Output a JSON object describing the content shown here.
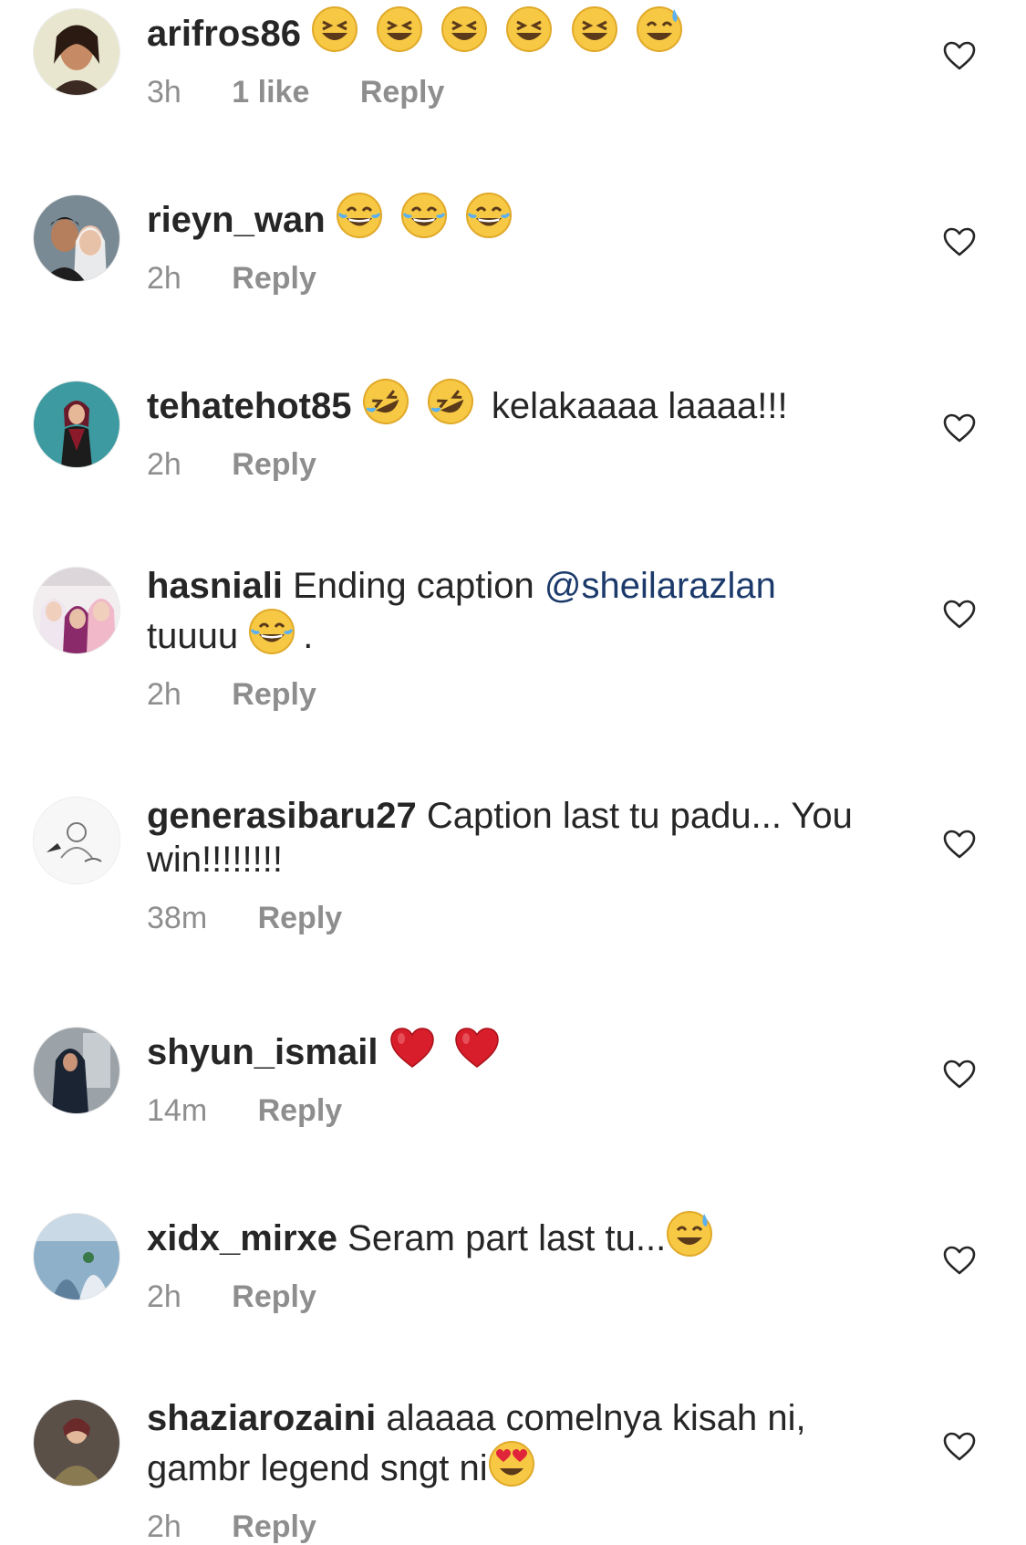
{
  "comments": [
    {
      "username": "arifros86",
      "text": "",
      "emoji": [
        "😆",
        "😆",
        "😆",
        "😆",
        "😆",
        "😅"
      ],
      "time": "3h",
      "likes": "1 like",
      "reply": "Reply"
    },
    {
      "username": "rieyn_wan",
      "text": "",
      "emoji": [
        "😂",
        "😂",
        "😂"
      ],
      "time": "2h",
      "reply": "Reply"
    },
    {
      "username": "tehatehot85",
      "text_after": "kelakaaaa laaaa!!!",
      "emoji": [
        "🤣",
        "🤣"
      ],
      "time": "2h",
      "reply": "Reply"
    },
    {
      "username": "hasniali",
      "text": "Ending caption",
      "mention": "@sheilarazlan",
      "text2": "tuuuu",
      "emoji": [
        "😂"
      ],
      "suffix": ".",
      "time": "2h",
      "reply": "Reply"
    },
    {
      "username": "generasibaru27",
      "text": "Caption last tu padu... You win!!!!!!!!",
      "time": "38m",
      "reply": "Reply"
    },
    {
      "username": "shyun_ismail",
      "emoji": [
        "❤️",
        "❤️"
      ],
      "time": "14m",
      "reply": "Reply"
    },
    {
      "username": "xidx_mirxe",
      "text": "Seram part last tu...",
      "emoji": [
        "😅"
      ],
      "time": "2h",
      "reply": "Reply"
    },
    {
      "username": "shaziarozaini",
      "text": "alaaaa comelnya kisah ni, gambr legend sngt ni",
      "emoji": [
        "😍"
      ],
      "time": "2h",
      "reply": "Reply"
    }
  ],
  "colors": {
    "text": "#262626",
    "meta": "#8e8e8e",
    "mention": "#1b3a6b"
  }
}
